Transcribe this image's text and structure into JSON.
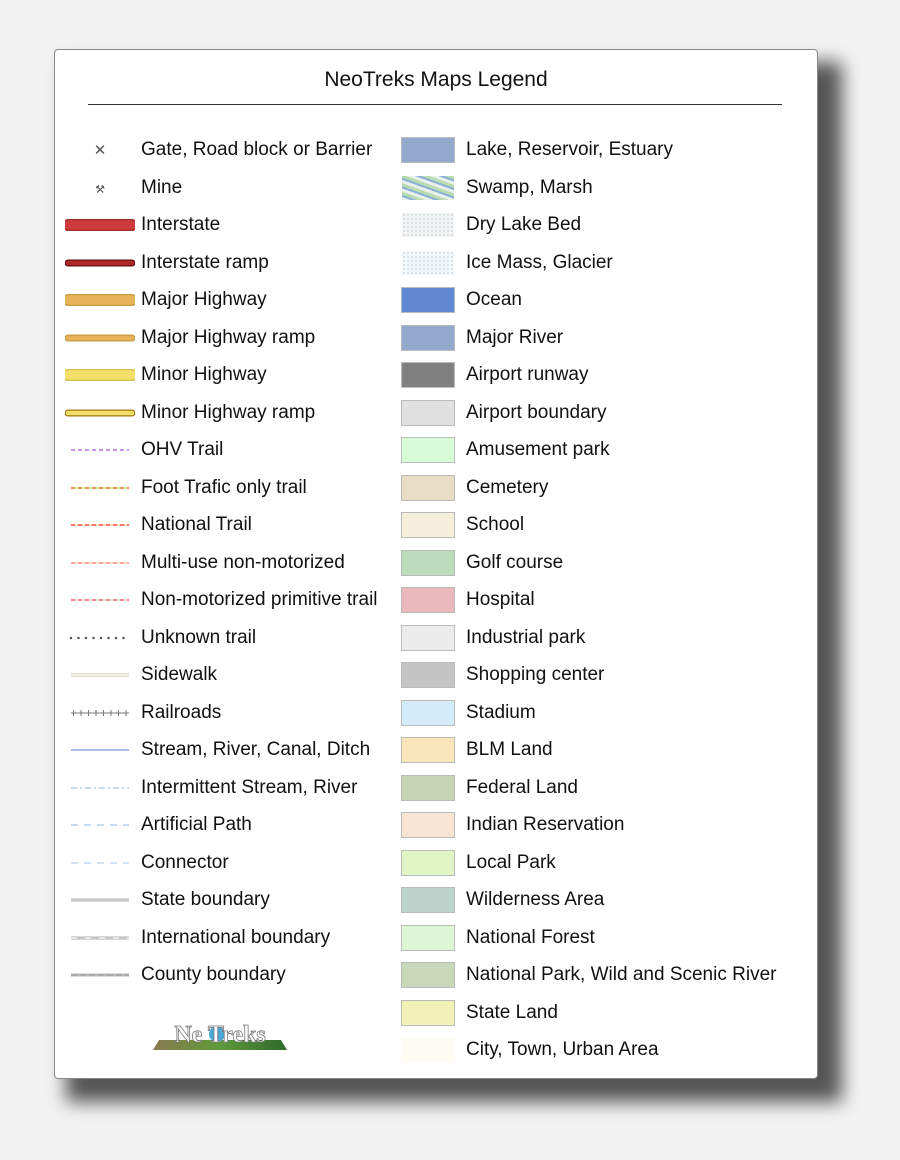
{
  "title": "NeoTreks Maps Legend",
  "logo_text": "NeoTreks",
  "left_items": [
    {
      "label": "Gate, Road block or Barrier",
      "symbol": {
        "type": "glyph",
        "glyph": "✕",
        "color": "#555555"
      }
    },
    {
      "label": "Mine",
      "symbol": {
        "type": "glyph",
        "glyph": "⚒",
        "color": "#555555"
      }
    },
    {
      "label": "Interstate",
      "symbol": {
        "type": "road",
        "color": "#cc3b3b",
        "outline": "#a02a2a",
        "weight": "wide"
      }
    },
    {
      "label": "Interstate ramp",
      "symbol": {
        "type": "road",
        "color": "#b02a2a",
        "outline": "#6a1010",
        "weight": "thin"
      }
    },
    {
      "label": "Major Highway",
      "symbol": {
        "type": "road",
        "color": "#e6b35a",
        "outline": "#c99a40",
        "weight": "wide"
      }
    },
    {
      "label": "Major Highway ramp",
      "symbol": {
        "type": "road",
        "color": "#e6b35a",
        "outline": "#c99a40",
        "weight": "thin"
      }
    },
    {
      "label": "Minor Highway",
      "symbol": {
        "type": "road",
        "color": "#f3df6a",
        "outline": "#d8c050",
        "weight": "wide"
      }
    },
    {
      "label": "Minor Highway ramp",
      "symbol": {
        "type": "road",
        "color": "#f3df6a",
        "outline": "#a07a10",
        "weight": "thin"
      }
    },
    {
      "label": "OHV Trail",
      "symbol": {
        "type": "dash",
        "color": "#c070e0"
      }
    },
    {
      "label": "Foot Trafic only trail",
      "symbol": {
        "type": "dash",
        "color": "#ff7050",
        "alt": "#c8f060"
      }
    },
    {
      "label": "National Trail",
      "symbol": {
        "type": "dash",
        "color": "#ff5040",
        "alt": "#ffd0a0"
      }
    },
    {
      "label": "Multi-use non-motorized",
      "symbol": {
        "type": "dash",
        "color": "#ff9080",
        "alt": "#ffe0c0"
      }
    },
    {
      "label": "Non-motorized primitive trail",
      "symbol": {
        "type": "dash",
        "color": "#ff6070",
        "alt": "#dddddd"
      }
    },
    {
      "label": "Unknown trail",
      "symbol": {
        "type": "dots",
        "color": "#555555"
      }
    },
    {
      "label": "Sidewalk",
      "symbol": {
        "type": "double",
        "color": "#e0e0c8"
      }
    },
    {
      "label": "Railroads",
      "symbol": {
        "type": "rail",
        "color": "#777777"
      }
    },
    {
      "label": "Stream, River, Canal, Ditch",
      "symbol": {
        "type": "solid",
        "color": "#8aa8d8"
      }
    },
    {
      "label": "Intermittent Stream, River",
      "symbol": {
        "type": "dashdot",
        "color": "#a8c4e4"
      }
    },
    {
      "label": "Artificial Path",
      "symbol": {
        "type": "longdash",
        "color": "#a8c4e4"
      }
    },
    {
      "label": "Connector",
      "symbol": {
        "type": "longdash",
        "color": "#b8d0ee"
      }
    },
    {
      "label": "State boundary",
      "symbol": {
        "type": "thick",
        "color": "#c8c8c8"
      }
    },
    {
      "label": "International boundary",
      "symbol": {
        "type": "intl",
        "color": "#c8c8c8"
      }
    },
    {
      "label": "County boundary",
      "symbol": {
        "type": "county",
        "color": "#b8b8b8"
      }
    }
  ],
  "right_items": [
    {
      "label": "Lake, Reservoir, Estuary",
      "fill": "#93a8cc"
    },
    {
      "label": "Swamp, Marsh",
      "fill": "#cfe4d8",
      "pattern": "swamp"
    },
    {
      "label": "Dry Lake Bed",
      "fill": "#f2f2f2",
      "pattern": "speckle"
    },
    {
      "label": "Ice Mass, Glacier",
      "fill": "#f4f8fb",
      "pattern": "speckle"
    },
    {
      "label": "Ocean",
      "fill": "#6189d4"
    },
    {
      "label": "Major River",
      "fill": "#93a8cc"
    },
    {
      "label": "Airport runway",
      "fill": "#808080"
    },
    {
      "label": "Airport boundary",
      "fill": "#e0e0e0"
    },
    {
      "label": "Amusement park",
      "fill": "#d8fbd8"
    },
    {
      "label": "Cemetery",
      "fill": "#e7dcc4"
    },
    {
      "label": "School",
      "fill": "#f5eeda"
    },
    {
      "label": "Golf course",
      "fill": "#bcdcbc"
    },
    {
      "label": "Hospital",
      "fill": "#e8b8bc"
    },
    {
      "label": "Industrial park",
      "fill": "#ececec"
    },
    {
      "label": "Shopping center",
      "fill": "#c4c4c4"
    },
    {
      "label": "Stadium",
      "fill": "#d4ecfa"
    },
    {
      "label": "BLM Land",
      "fill": "#fbe6bc"
    },
    {
      "label": "Federal Land",
      "fill": "#c8d4b4"
    },
    {
      "label": "Indian Reservation",
      "fill": "#f7e4d2"
    },
    {
      "label": "Local Park",
      "fill": "#e0f4c4"
    },
    {
      "label": "Wilderness Area",
      "fill": "#bcd4cc"
    },
    {
      "label": "National Forest",
      "fill": "#dcf6d6"
    },
    {
      "label": "National Park, Wild and Scenic River",
      "fill": "#c8d8b8"
    },
    {
      "label": "State Land",
      "fill": "#f2f2b8"
    },
    {
      "label": "City, Town, Urban Area",
      "fill": "#fefaf4"
    }
  ]
}
